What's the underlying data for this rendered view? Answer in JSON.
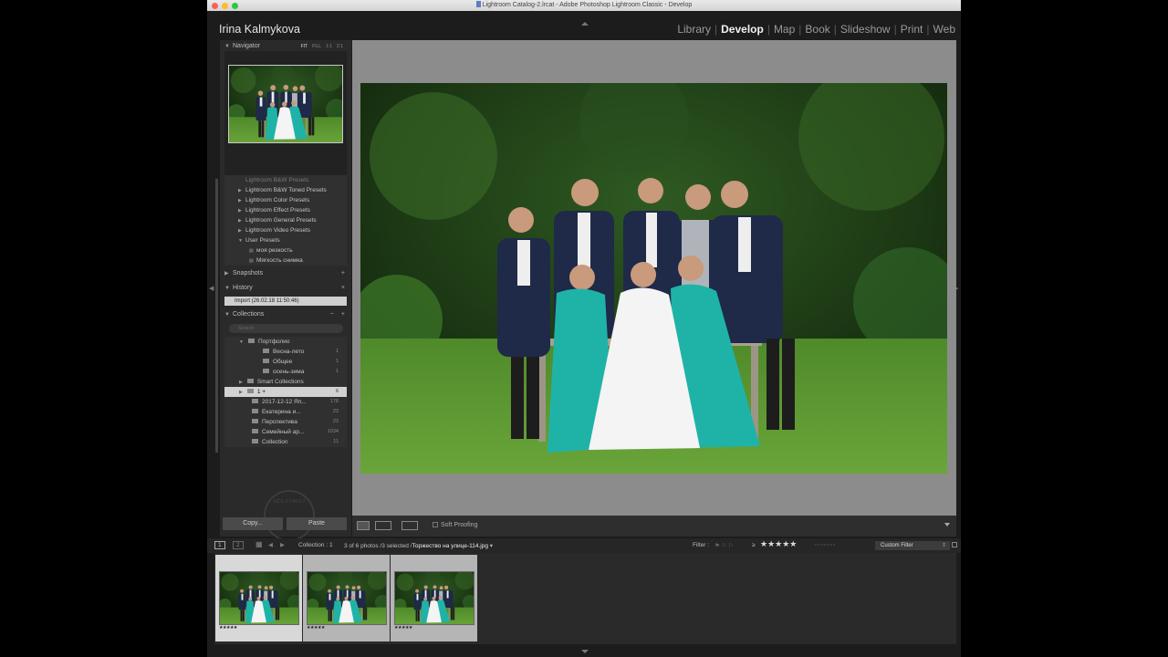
{
  "window": {
    "title": "Lightroom Catalog-2.lrcat - Adobe Photoshop Lightroom Classic - Develop"
  },
  "identity_plate": "Irina Kalmykova",
  "modules": [
    {
      "label": "Library",
      "active": false
    },
    {
      "label": "Develop",
      "active": true
    },
    {
      "label": "Map",
      "active": false
    },
    {
      "label": "Book",
      "active": false
    },
    {
      "label": "Slideshow",
      "active": false
    },
    {
      "label": "Print",
      "active": false
    },
    {
      "label": "Web",
      "active": false
    }
  ],
  "navigator": {
    "title": "Navigator",
    "zoom_options": [
      "FIT",
      "FILL",
      "1:1",
      "2:1"
    ]
  },
  "presets": {
    "partial_item": "Lightroom B&W Presets",
    "items": [
      "Lightroom B&W Toned Presets",
      "Lightroom Color Presets",
      "Lightroom Effect Presets",
      "Lightroom General Presets",
      "Lightroom Video Presets",
      "User Presets"
    ],
    "user_presets": [
      "моя резкость",
      "Мягкость снимка"
    ]
  },
  "snapshots": {
    "title": "Snapshots"
  },
  "history": {
    "title": "History",
    "items": [
      "Import (26.02.18 11:50:46)"
    ]
  },
  "collections": {
    "title": "Collections",
    "search_placeholder": "Search",
    "items": [
      {
        "label": "Портфолио",
        "count": ""
      },
      {
        "label": "Весна-лето",
        "count": "1"
      },
      {
        "label": "Общее",
        "count": "1"
      },
      {
        "label": "осень-зима",
        "count": "1"
      },
      {
        "label": "Smart Collections",
        "count": ""
      },
      {
        "label": "1 +",
        "count": "6"
      },
      {
        "label": "2017-12-12 Яп...",
        "count": "178"
      },
      {
        "label": "Екатерина и...",
        "count": "23"
      },
      {
        "label": "Перспектива",
        "count": "23"
      },
      {
        "label": "Семейный ар...",
        "count": "1034"
      },
      {
        "label": "Collection",
        "count": "11"
      }
    ]
  },
  "stamp_text": "KIDS & FAMILY",
  "buttons": {
    "copy": "Copy...",
    "paste": "Paste"
  },
  "toolbar": {
    "soft_proofing": "Soft Proofing"
  },
  "filmstrip_bar": {
    "page1": "1",
    "page2": "2",
    "source": "Collection : 1",
    "info_prefix": "3 of 6 photos /3 selected /",
    "filename": "Торжество на улице-114.jpg",
    "filter_label": "Filter :",
    "rating_op": "≥",
    "stars": "★★★★★",
    "custom_filter": "Custom Filter"
  },
  "thumbnails": [
    {
      "rating": "★★★★★",
      "state": "selected"
    },
    {
      "rating": "★★★★★",
      "state": "selected-dim"
    },
    {
      "rating": "★★★★★",
      "state": "selected-dim"
    }
  ],
  "colors": {
    "accent_panel": "#2a2a2a",
    "background": "#8c8c8c",
    "teal_dress": "#1fb3a8"
  }
}
